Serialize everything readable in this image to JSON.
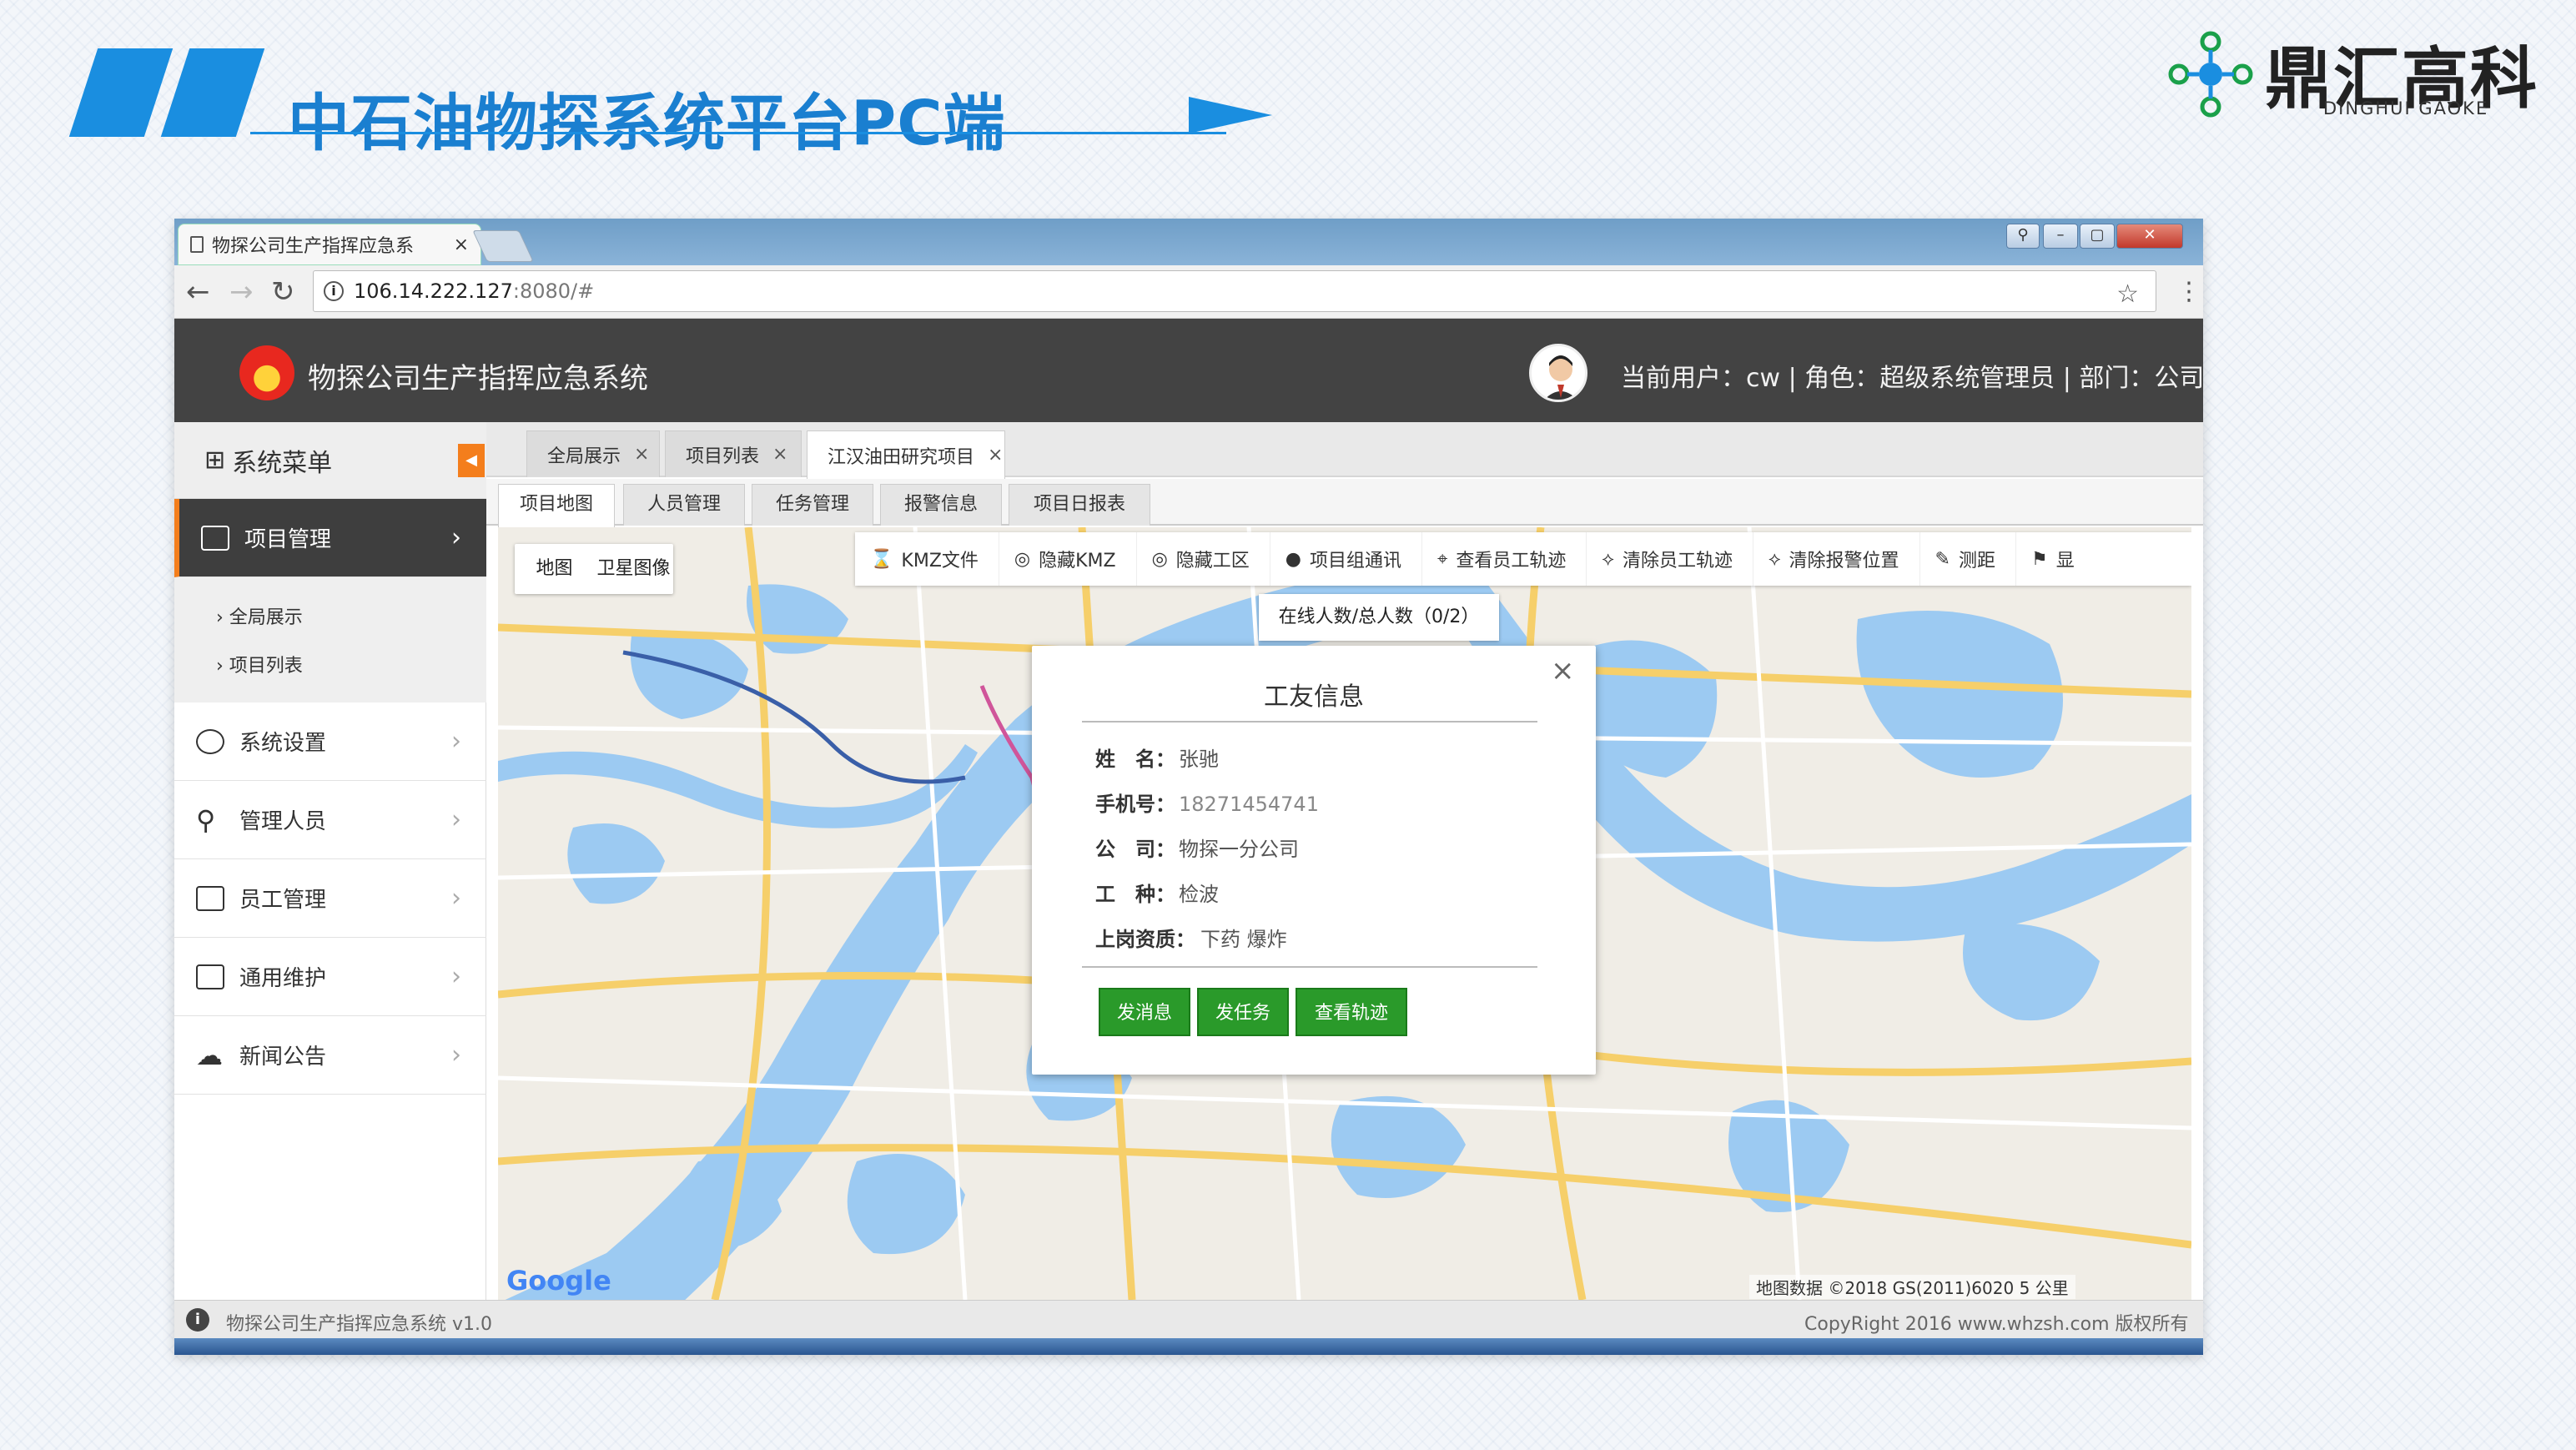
{
  "slide": {
    "title": "中石油物探系统平台PC端",
    "brand_name": "鼎汇高科",
    "brand_sub": "DINGHUI GAOKE"
  },
  "browser": {
    "tab_title": "物探公司生产指挥应急系",
    "url_host": "106.14.222.127",
    "url_rest": ":8080/#"
  },
  "app": {
    "name": "物探公司生产指挥应急系统",
    "user_info": "当前用户：cw  | 角色：超级系统管理员 | 部门：公司"
  },
  "sidebar": {
    "header": "系统菜单",
    "items": [
      {
        "label": "项目管理"
      },
      {
        "label": "系统设置"
      },
      {
        "label": "管理人员"
      },
      {
        "label": "员工管理"
      },
      {
        "label": "通用维护"
      },
      {
        "label": "新闻公告"
      }
    ],
    "sub_items": [
      "全局展示",
      "项目列表"
    ]
  },
  "tabs": [
    "全局展示",
    "项目列表",
    "江汉油田研究项目"
  ],
  "subtabs": [
    "项目地图",
    "人员管理",
    "任务管理",
    "报警信息",
    "项目日报表"
  ],
  "map": {
    "types": [
      "地图",
      "卫星图像"
    ],
    "toolbar": [
      "KMZ文件",
      "隐藏KMZ",
      "隐藏工区",
      "项目组通讯",
      "查看员工轨迹",
      "清除员工轨迹",
      "清除报警位置",
      "测距",
      "显"
    ],
    "online": "在线人数/总人数（0/2）",
    "google": "Google",
    "copyright": "地图数据 ©2018 GS(2011)6020  5 公里"
  },
  "popup": {
    "title": "工友信息",
    "fields": [
      {
        "label": "姓　名：",
        "value": "张驰"
      },
      {
        "label": "手机号：",
        "value": "18271454741"
      },
      {
        "label": "公　司：",
        "value": "物探一分公司"
      },
      {
        "label": "工　种：",
        "value": "检波"
      },
      {
        "label": "上岗资质：",
        "value": "下药 爆炸"
      }
    ],
    "buttons": [
      "发消息",
      "发任务",
      "查看轨迹"
    ],
    "close": "×"
  },
  "status": {
    "left": "物探公司生产指挥应急系统 v1.0",
    "right": "CopyRight 2016  www.whzsh.com 版权所有"
  }
}
